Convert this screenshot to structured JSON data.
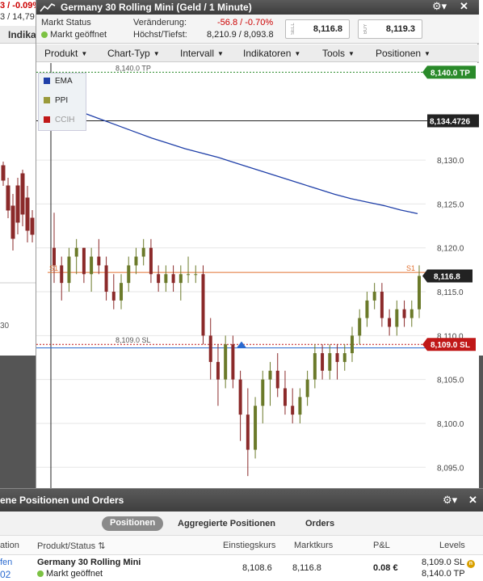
{
  "background": {
    "ticker_change": "3 / -0.09%",
    "ticker_values": "3 / 14,79",
    "nav_label": "Indika",
    "axis_label": "30"
  },
  "window": {
    "title": "Germany 30 Rolling Mini (Geld / 1 Minute)",
    "market_status_label": "Markt Status",
    "market_status_value": "Markt geöffnet",
    "change_label": "Veränderung:",
    "change_value": "-56.8",
    "change_pct": "-0.70%",
    "highlow_label": "Höchst/Tiefst:",
    "highlow_value": "8,210.9 / 8,093.8",
    "sell_tag": "SELL",
    "sell_price": "8,116.8",
    "buy_tag": "BUY",
    "buy_price": "8,119.3",
    "gear_icon": "⚙▾",
    "close_icon": "✕"
  },
  "menu": {
    "produkt": "Produkt",
    "charttyp": "Chart-Typ",
    "intervall": "Intervall",
    "indikatoren": "Indikatoren",
    "tools": "Tools",
    "positionen": "Positionen"
  },
  "legend": {
    "ema": "EMA",
    "ppi": "PPI",
    "ccih": "CCIH"
  },
  "colors": {
    "ema": "#1f3fa8",
    "ppi": "#9a9a3a",
    "ccih": "#c01818",
    "up": "#6b7a2a",
    "down": "#8b2a2a",
    "tp": "#2a8a2a",
    "sl": "#c01818",
    "s1": "#e07030",
    "level_blue": "#2a6ad0"
  },
  "chart_data": {
    "type": "candlestick",
    "y_ticks": [
      8095.0,
      8100.0,
      8105.0,
      8110.0,
      8115.0,
      8120.0,
      8125.0,
      8130.0
    ],
    "y_tick_labels": [
      "8,095.0",
      "8,100.0",
      "8,105.0",
      "8,110.0",
      "8,115.0",
      "8,120.0",
      "8,125.0",
      "8,130.0"
    ],
    "ylim": [
      8093.0,
      8140.5
    ],
    "ema_start_label": "EMA",
    "ema": [
      8136.0,
      8135.3,
      8134.6,
      8133.9,
      8133.2,
      8132.5,
      8131.9,
      8131.3,
      8130.8,
      8130.3,
      8129.7,
      8129.1,
      8128.5,
      8127.9,
      8127.3,
      8126.7,
      8126.1,
      8125.6,
      8125.2,
      8124.8,
      8124.3,
      8123.9
    ],
    "candles_ohlc": [
      [
        8120,
        8124,
        8116,
        8118
      ],
      [
        8118,
        8119,
        8114,
        8116
      ],
      [
        8116,
        8120,
        8115,
        8119
      ],
      [
        8119,
        8121,
        8117,
        8120
      ],
      [
        8120,
        8120,
        8116,
        8117
      ],
      [
        8117,
        8120,
        8115,
        8119
      ],
      [
        8119,
        8121,
        8117,
        8118
      ],
      [
        8118,
        8119,
        8114,
        8115
      ],
      [
        8115,
        8117,
        8113,
        8114
      ],
      [
        8114,
        8117,
        8113,
        8116
      ],
      [
        8116,
        8119,
        8115,
        8118
      ],
      [
        8118,
        8120,
        8117,
        8119
      ],
      [
        8119,
        8121,
        8118,
        8120
      ],
      [
        8120,
        8121,
        8116,
        8117
      ],
      [
        8117,
        8118,
        8115,
        8116
      ],
      [
        8116,
        8118,
        8115,
        8117
      ],
      [
        8117,
        8118,
        8115,
        8116
      ],
      [
        8116,
        8118,
        8114,
        8117
      ],
      [
        8117,
        8119,
        8116,
        8117
      ],
      [
        8117,
        8118,
        8116,
        8117
      ],
      [
        8117,
        8118,
        8109,
        8110
      ],
      [
        8110,
        8112,
        8105,
        8107
      ],
      [
        8107,
        8109,
        8102,
        8105
      ],
      [
        8105,
        8110,
        8104,
        8109
      ],
      [
        8109,
        8110,
        8104,
        8105
      ],
      [
        8105,
        8106,
        8098,
        8101
      ],
      [
        8101,
        8104,
        8094,
        8097
      ],
      [
        8097,
        8103,
        8096,
        8102
      ],
      [
        8102,
        8106,
        8100,
        8105
      ],
      [
        8105,
        8107,
        8102,
        8106
      ],
      [
        8106,
        8108,
        8103,
        8104
      ],
      [
        8104,
        8106,
        8101,
        8102
      ],
      [
        8102,
        8104,
        8100,
        8101
      ],
      [
        8101,
        8104,
        8100,
        8103
      ],
      [
        8103,
        8106,
        8102,
        8105
      ],
      [
        8105,
        8109,
        8104,
        8108
      ],
      [
        8108,
        8109,
        8105,
        8106
      ],
      [
        8106,
        8109,
        8105,
        8108
      ],
      [
        8108,
        8109,
        8105,
        8107
      ],
      [
        8107,
        8109,
        8106,
        8108
      ],
      [
        8108,
        8111,
        8107,
        8110
      ],
      [
        8110,
        8113,
        8109,
        8112
      ],
      [
        8112,
        8115,
        8111,
        8114
      ],
      [
        8114,
        8116,
        8113,
        8115
      ],
      [
        8115,
        8116,
        8111,
        8112
      ],
      [
        8112,
        8113,
        8110,
        8111
      ],
      [
        8111,
        8114,
        8110,
        8113
      ],
      [
        8113,
        8114,
        8111,
        8112
      ],
      [
        8112,
        8114,
        8111,
        8113
      ],
      [
        8113,
        8118,
        8112,
        8116.8
      ]
    ],
    "tp_level": "8,140.0 TP",
    "tp_value": 8140.0,
    "sl_level": "8,109.0 SL",
    "sl_value": 8109.0,
    "s1_label": "S1",
    "s1_value": 8117.2,
    "entry_value": 8108.6,
    "crosshair_price": "8,134.4726",
    "crosshair_value": 8134.47,
    "current_price": "8,116.8",
    "current_value": 8116.8,
    "sl_tag": "8,109.0 SL",
    "tp_tag": "8,140.0 TP"
  },
  "panel": {
    "title": "ene Positionen und Orders",
    "tabs": [
      "Positionen",
      "Aggregierte Positionen",
      "Orders"
    ],
    "headers": {
      "left": "ation",
      "product": "Produkt/Status",
      "entry": "Einstiegskurs",
      "market": "Marktkurs",
      "pl": "P&L",
      "levels": "Levels"
    },
    "row": {
      "left1": "fen",
      "left2": "02",
      "product": "Germany 30 Rolling Mini",
      "status": "Markt geöffnet",
      "entry": "8,108.6",
      "market": "8,116.8",
      "pl": "0.08 €",
      "level_sl": "8,109.0 SL",
      "level_tp": "8,140.0 TP",
      "badge": "n"
    }
  }
}
